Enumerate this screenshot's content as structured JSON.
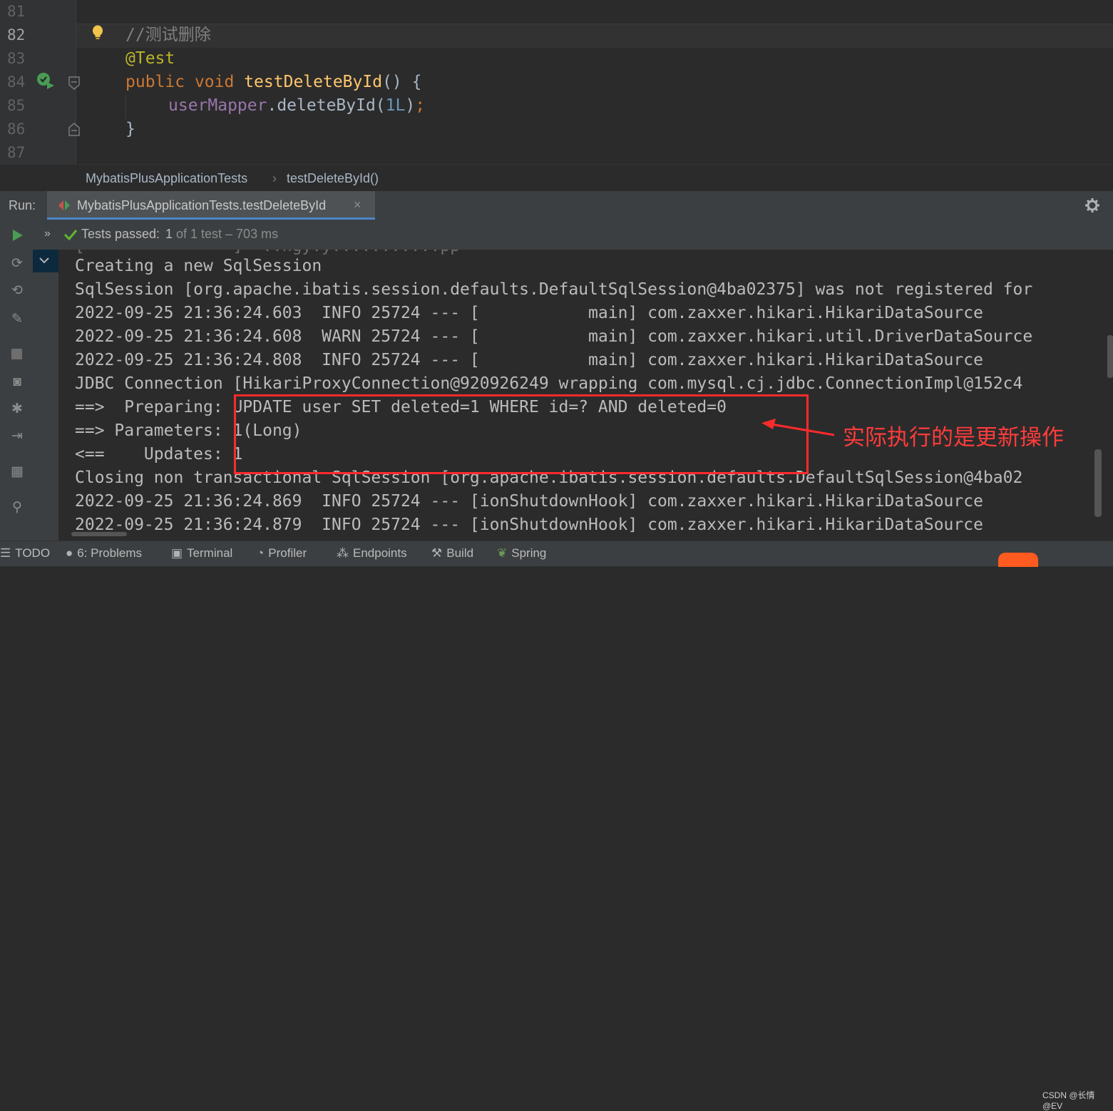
{
  "editor": {
    "line_numbers": [
      "81",
      "82",
      "83",
      "84",
      "85",
      "86",
      "87"
    ],
    "lines": {
      "comment": "//测试删除",
      "annotation": "@Test",
      "kw_public": "public",
      "kw_void": "void",
      "method": "testDeleteById",
      "sig_tail": "() {",
      "field": "userMapper",
      "call": ".deleteById(",
      "num": "1L",
      "call_tail": ")",
      "semicolon": ";",
      "close": "}"
    }
  },
  "breadcrumb": {
    "class_name": "MybatisPlusApplicationTests",
    "method_name": "testDeleteById()"
  },
  "run_panel": {
    "label": "Run:",
    "tab_title": "MybatisPlusApplicationTests.testDeleteById",
    "status_passed": "Tests passed:",
    "status_count": "1",
    "status_detail": "of 1 test – 703 ms"
  },
  "console": {
    "lines": [
      "Creating a new SqlSession",
      "SqlSession [org.apache.ibatis.session.defaults.DefaultSqlSession@4ba02375] was not registered for",
      "2022-09-25 21:36:24.603  INFO 25724 --- [           main] com.zaxxer.hikari.HikariDataSource",
      "2022-09-25 21:36:24.608  WARN 25724 --- [           main] com.zaxxer.hikari.util.DriverDataSource",
      "2022-09-25 21:36:24.808  INFO 25724 --- [           main] com.zaxxer.hikari.HikariDataSource",
      "JDBC Connection [HikariProxyConnection@920926249 wrapping com.mysql.cj.jdbc.ConnectionImpl@152c4",
      "==>  Preparing: UPDATE user SET deleted=1 WHERE id=? AND deleted=0",
      "==> Parameters: 1(Long)",
      "<==    Updates: 1",
      "Closing non transactional SqlSession [org.apache.ibatis.session.defaults.DefaultSqlSession@4ba02",
      "2022-09-25 21:36:24.869  INFO 25724 --- [ionShutdownHook] com.zaxxer.hikari.HikariDataSource",
      "2022-09-25 21:36:24.879  INFO 25724 --- [ionShutdownHook] com.zaxxer.hikari.HikariDataSource"
    ]
  },
  "annotation_note": "实际执行的是更新操作",
  "bottom_tabs": {
    "todo": "TODO",
    "problems": "6: Problems",
    "terminal": "Terminal",
    "profiler": "Profiler",
    "endpoints": "Endpoints",
    "build": "Build",
    "spring": "Spring"
  },
  "watermark": "CSDN @长情@EV",
  "colors": {
    "background": "#2b2b2b",
    "keyword": "#cc7832",
    "method": "#ffc66d",
    "annotation_box": "#ff2b2b",
    "passed_check": "#5fb832"
  }
}
